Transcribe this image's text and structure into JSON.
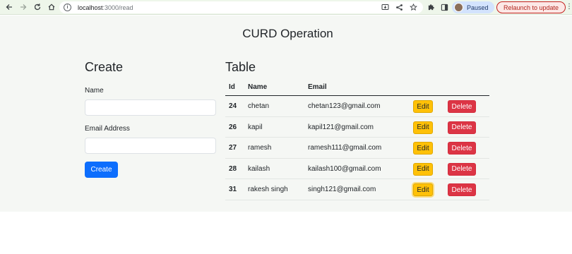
{
  "browser": {
    "url_host": "localhost",
    "url_path": ":3000/read",
    "profile_status": "Paused",
    "relaunch_label": "Relaunch to update"
  },
  "icons": {
    "back": "back-arrow-icon",
    "forward": "forward-arrow-icon",
    "reload": "reload-icon",
    "home": "home-icon",
    "site_info": "site-info-icon",
    "install": "install-app-icon",
    "share": "share-icon",
    "bookmark": "star-icon",
    "extensions": "puzzle-icon",
    "side_panel": "side-panel-icon",
    "menu": "kebab-menu-icon"
  },
  "page": {
    "title": "CURD Operation"
  },
  "create_form": {
    "heading": "Create",
    "name_label": "Name",
    "name_value": "",
    "email_label": "Email Address",
    "email_value": "",
    "submit_label": "Create"
  },
  "table": {
    "heading": "Table",
    "columns": [
      "Id",
      "Name",
      "Email"
    ],
    "edit_label": "Edit",
    "delete_label": "Delete",
    "rows": [
      {
        "id": "24",
        "name": "chetan",
        "email": "chetan123@gmail.com"
      },
      {
        "id": "26",
        "name": "kapil",
        "email": "kapil121@gmail.com"
      },
      {
        "id": "27",
        "name": "ramesh",
        "email": "ramesh111@gmail.com"
      },
      {
        "id": "28",
        "name": "kailash",
        "email": "kailash100@gmail.com"
      },
      {
        "id": "31",
        "name": "rakesh singh",
        "email": "singh121@gmail.com"
      }
    ]
  },
  "colors": {
    "primary": "#0d6efd",
    "warning": "#ffc107",
    "danger": "#dc3545"
  }
}
